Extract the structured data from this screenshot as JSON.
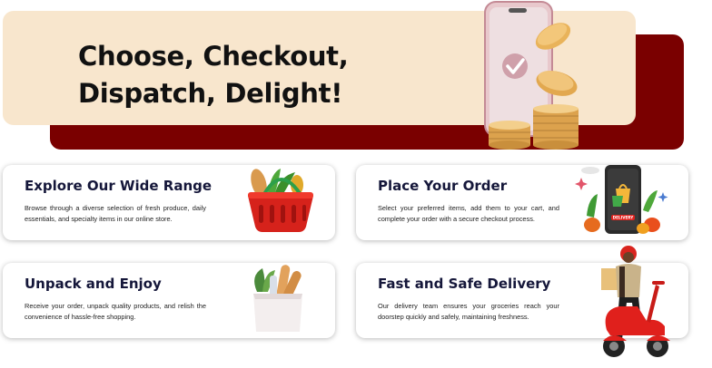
{
  "hero": {
    "title_line1": "Choose, Checkout,",
    "title_line2": "Dispatch, Delight!"
  },
  "cards": [
    {
      "title": "Explore Our Wide Range",
      "description": "Browse through a diverse selection of fresh produce, daily essentials, and specialty items in our online store.",
      "icon": "shopping-basket-icon"
    },
    {
      "title": "Place Your Order",
      "description": "Select your preferred items, add them to your cart, and complete your order with a secure checkout process.",
      "icon": "mobile-order-icon"
    },
    {
      "title": "Unpack and Enjoy",
      "description": "Receive your order, unpack quality products, and relish the convenience of hassle-free shopping.",
      "icon": "grocery-bag-icon"
    },
    {
      "title": "Fast and Safe Delivery",
      "description": "Our delivery team ensures your groceries reach your doorstep quickly and safely, maintaining freshness.",
      "icon": "delivery-scooter-icon"
    }
  ],
  "phone_badge_text": "DELIVERY",
  "colors": {
    "hero_back": "#7a0000",
    "hero_front": "#f8e6cd",
    "card_title": "#15173a",
    "accent_red": "#e0201c"
  }
}
